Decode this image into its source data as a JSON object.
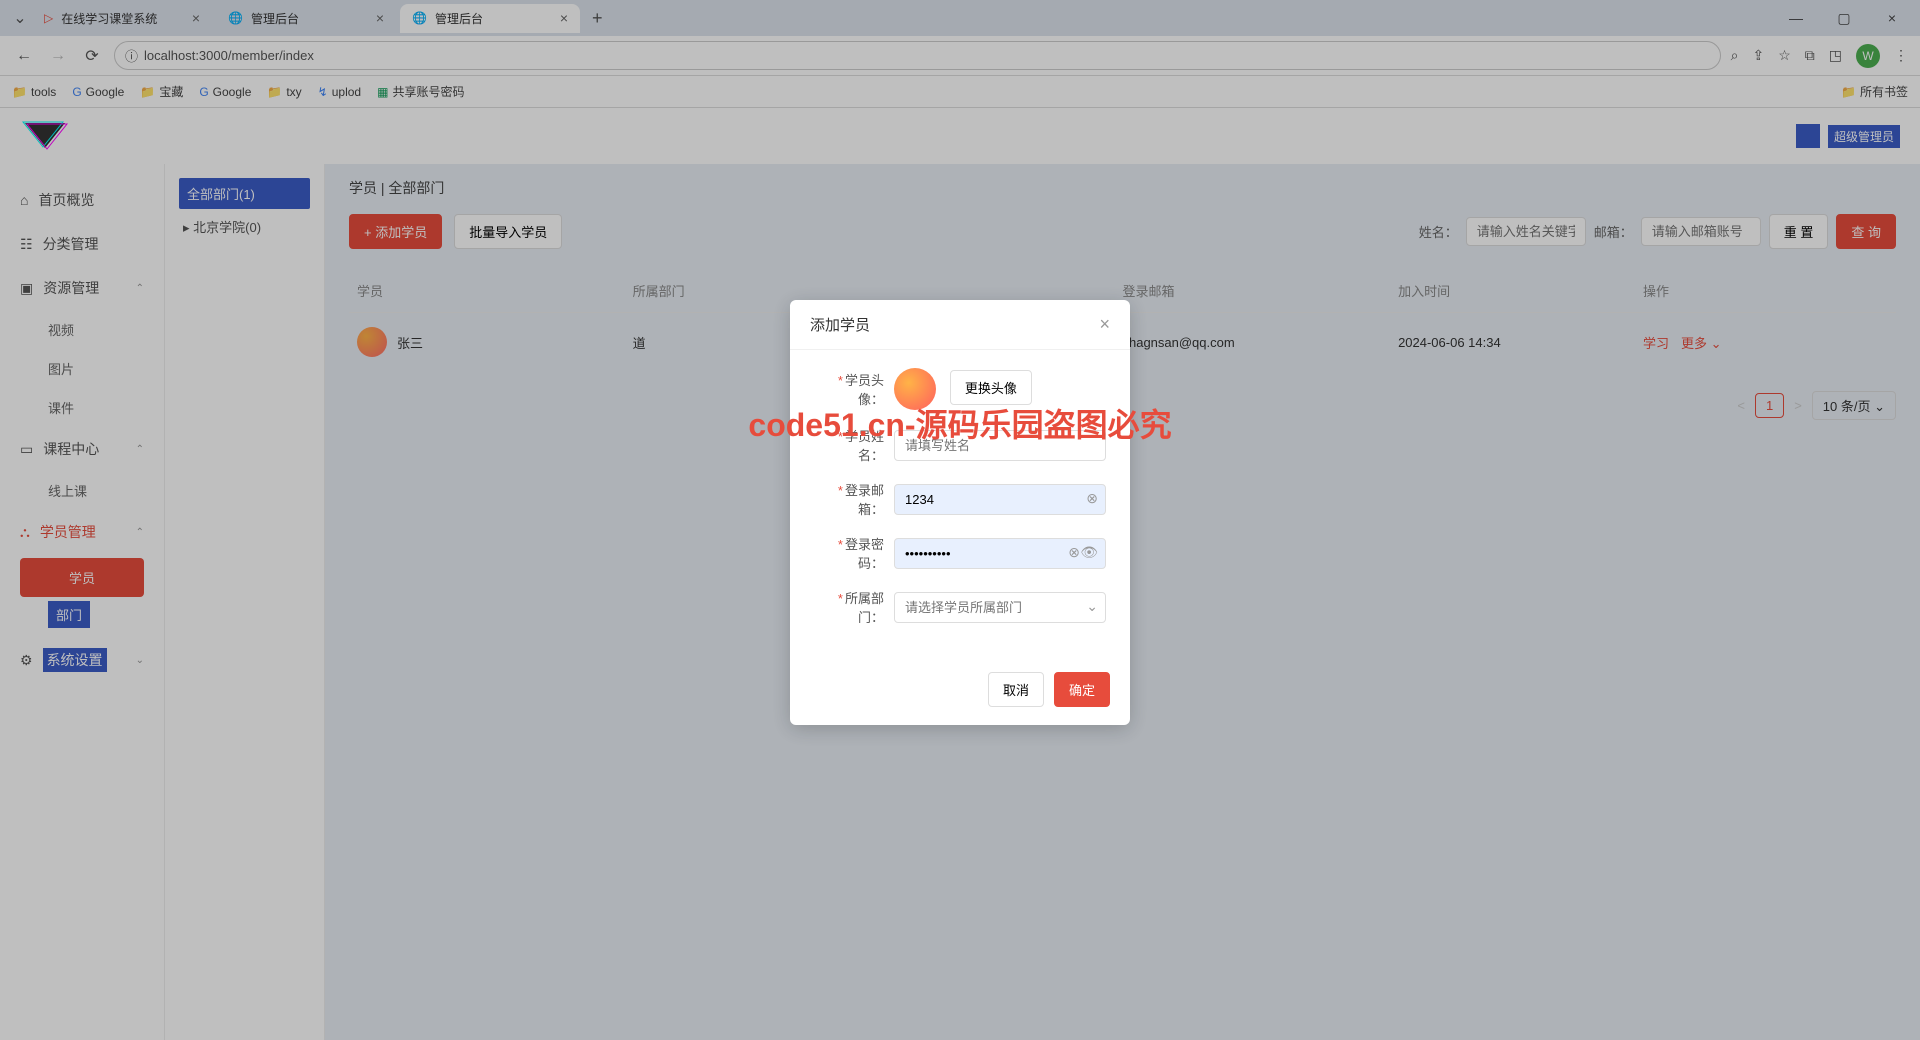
{
  "browser": {
    "tabs": [
      {
        "title": "在线学习课堂系统",
        "icon": "play"
      },
      {
        "title": "管理后台",
        "icon": "globe"
      },
      {
        "title": "管理后台",
        "icon": "globe",
        "active": true
      }
    ],
    "url": "localhost:3000/member/index",
    "bookmarks": [
      "tools",
      "Google",
      "宝藏",
      "Google",
      "txy",
      "uplod",
      "共享账号密码"
    ],
    "all_bookmarks": "所有书签",
    "profile_letter": "W"
  },
  "header": {
    "user_role": "超级管理员"
  },
  "sidebar": {
    "items": [
      {
        "icon": "home",
        "label": "首页概览"
      },
      {
        "icon": "category",
        "label": "分类管理"
      },
      {
        "icon": "resource",
        "label": "资源管理",
        "expand": true,
        "children": [
          "视频",
          "图片",
          "课件"
        ]
      },
      {
        "icon": "course",
        "label": "课程中心",
        "expand": true,
        "children": [
          "线上课"
        ]
      },
      {
        "icon": "member",
        "label": "学员管理",
        "active": true,
        "expand": true,
        "children_special": [
          "学员",
          "部门"
        ]
      },
      {
        "icon": "settings",
        "label": "系统设置",
        "expand": true
      }
    ]
  },
  "tree": {
    "active": "全部部门(1)",
    "child": "北京学院(0)"
  },
  "breadcrumb": "学员 | 全部部门",
  "toolbar": {
    "add_btn": "添加学员",
    "import_btn": "批量导入学员",
    "name_label": "姓名：",
    "name_placeholder": "请输入姓名关键字",
    "email_label": "邮箱：",
    "email_placeholder": "请输入邮箱账号",
    "reset_btn": "重 置",
    "query_btn": "查 询"
  },
  "table": {
    "headers": {
      "member": "学员",
      "dept": "所属部门",
      "email": "登录邮箱",
      "joined": "加入时间",
      "op": "操作"
    },
    "rows": [
      {
        "name": "张三",
        "dept": "道",
        "email": "zhagnsan@qq.com",
        "joined": "2024-06-06 14:34",
        "op_learn": "学习",
        "op_more": "更多"
      }
    ]
  },
  "pagination": {
    "prev": "<",
    "page": "1",
    "next": ">",
    "size": "10 条/页"
  },
  "modal": {
    "title": "添加学员",
    "avatar_label": "学员头像：",
    "change_avatar_btn": "更换头像",
    "name_label": "学员姓名：",
    "name_placeholder": "请填写姓名",
    "email_label": "登录邮箱：",
    "email_value": "1234",
    "password_label": "登录密码：",
    "password_value": "••••••••••",
    "dept_label": "所属部门：",
    "dept_placeholder": "请选择学员所属部门",
    "cancel_btn": "取消",
    "ok_btn": "确定"
  },
  "watermark": "code51.cn-源码乐园盗图必究"
}
